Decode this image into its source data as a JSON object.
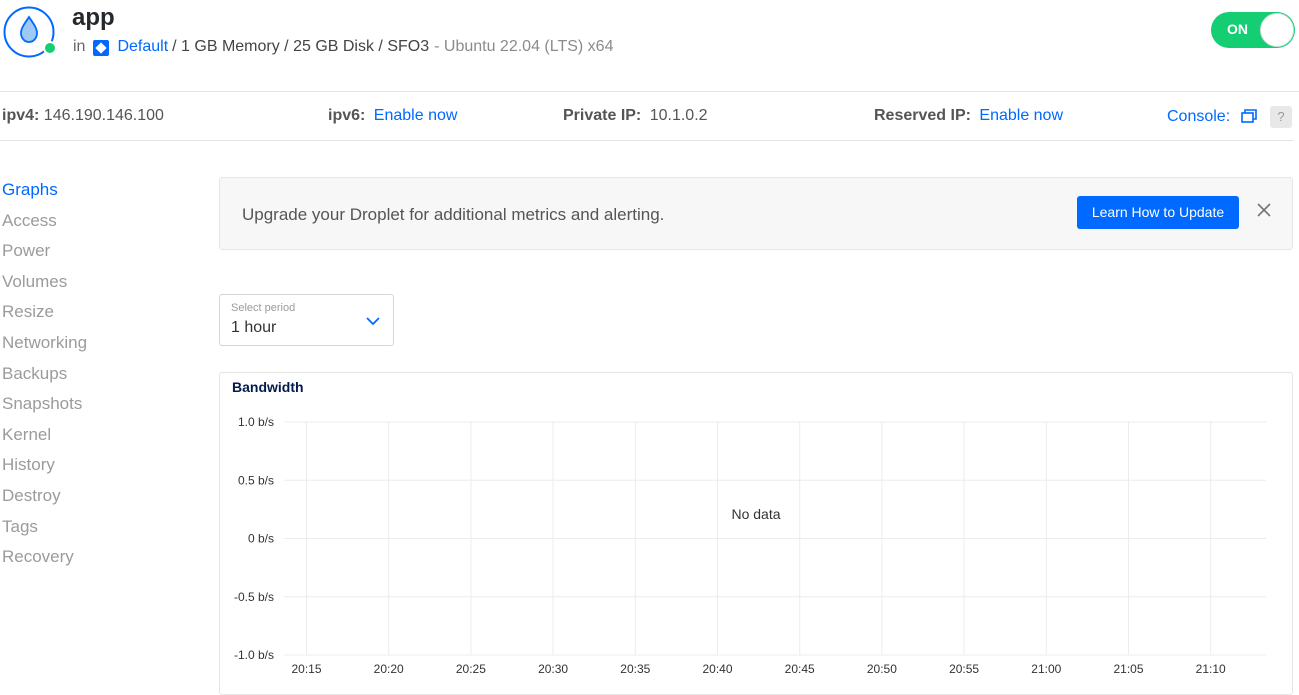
{
  "header": {
    "app_name": "app",
    "in_label": "in",
    "project": "Default",
    "specs": "/ 1 GB Memory / 25 GB Disk / SFO3",
    "os": "- Ubuntu 22.04 (LTS) x64",
    "power_toggle": "ON",
    "status_color": "#15cd72",
    "accent_color": "#0069ff"
  },
  "ipbar": {
    "ipv4_label": "ipv4:",
    "ipv4_value": "146.190.146.100",
    "ipv6_label": "ipv6:",
    "ipv6_action": "Enable now",
    "private_label": "Private IP:",
    "private_value": "10.1.0.2",
    "reserved_label": "Reserved IP:",
    "reserved_action": "Enable now",
    "console_label": "Console:",
    "help_label": "?"
  },
  "sidebar": {
    "items": [
      {
        "label": "Graphs",
        "active": true
      },
      {
        "label": "Access"
      },
      {
        "label": "Power"
      },
      {
        "label": "Volumes"
      },
      {
        "label": "Resize"
      },
      {
        "label": "Networking"
      },
      {
        "label": "Backups"
      },
      {
        "label": "Snapshots"
      },
      {
        "label": "Kernel"
      },
      {
        "label": "History"
      },
      {
        "label": "Destroy"
      },
      {
        "label": "Tags"
      },
      {
        "label": "Recovery"
      }
    ]
  },
  "banner": {
    "text": "Upgrade your Droplet for additional metrics and alerting.",
    "button": "Learn How to Update"
  },
  "period": {
    "label": "Select period",
    "value": "1 hour"
  },
  "chart_data": {
    "type": "line",
    "title": "Bandwidth",
    "y_ticks": [
      "1.0 b/s",
      "0.5 b/s",
      "0 b/s",
      "-0.5 b/s",
      "-1.0 b/s"
    ],
    "ylim": [
      -1.0,
      1.0
    ],
    "x_ticks": [
      "20:15",
      "20:20",
      "20:25",
      "20:30",
      "20:35",
      "20:40",
      "20:45",
      "20:50",
      "20:55",
      "21:00",
      "21:05",
      "21:10"
    ],
    "series": [],
    "empty_message": "No data",
    "grid": true
  }
}
